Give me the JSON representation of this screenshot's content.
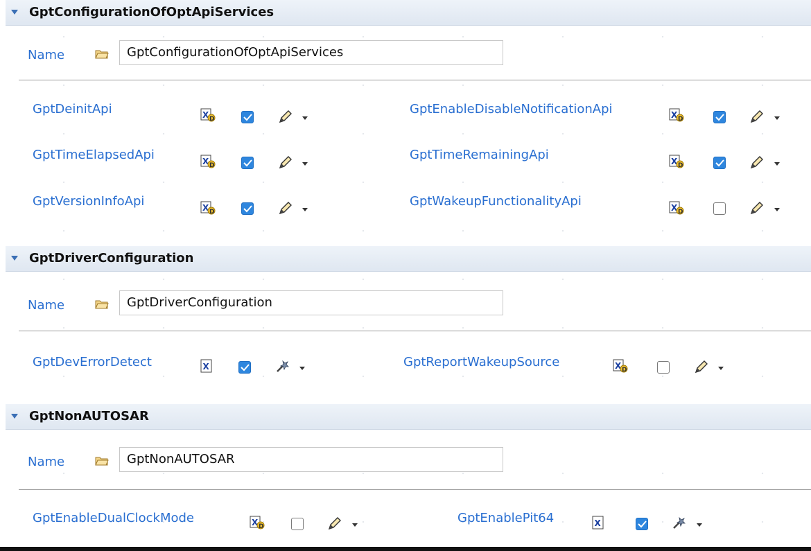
{
  "sections": [
    {
      "title": "GptConfigurationOfOptApiServices",
      "name_label": "Name",
      "name_value": "GptConfigurationOfOptApiServices",
      "params": [
        {
          "label": "GptDeinitApi",
          "icon": "xd-icon",
          "checked": true,
          "action_icon": "pencil-icon"
        },
        {
          "label": "GptEnableDisableNotificationApi",
          "icon": "xd-icon",
          "checked": true,
          "action_icon": "pencil-icon"
        },
        {
          "label": "GptTimeElapsedApi",
          "icon": "xd-icon",
          "checked": true,
          "action_icon": "pencil-icon"
        },
        {
          "label": "GptTimeRemainingApi",
          "icon": "xd-icon",
          "checked": true,
          "action_icon": "pencil-icon"
        },
        {
          "label": "GptVersionInfoApi",
          "icon": "xd-icon",
          "checked": true,
          "action_icon": "pencil-icon"
        },
        {
          "label": "GptWakeupFunctionalityApi",
          "icon": "xd-icon",
          "checked": false,
          "action_icon": "pencil-icon"
        }
      ]
    },
    {
      "title": "GptDriverConfiguration",
      "name_label": "Name",
      "name_value": "GptDriverConfiguration",
      "params": [
        {
          "label": "GptDevErrorDetect",
          "icon": "x-icon",
          "checked": true,
          "action_icon": "wand-icon"
        },
        {
          "label": "GptReportWakeupSource",
          "icon": "xd-icon",
          "checked": false,
          "action_icon": "pencil-icon"
        }
      ]
    },
    {
      "title": "GptNonAUTOSAR",
      "name_label": "Name",
      "name_value": "GptNonAUTOSAR",
      "params": [
        {
          "label": "GptEnableDualClockMode",
          "icon": "xd-icon",
          "checked": false,
          "action_icon": "pencil-icon"
        },
        {
          "label": "GptEnablePit64",
          "icon": "x-icon",
          "checked": true,
          "action_icon": "wand-icon"
        }
      ]
    }
  ],
  "colors": {
    "label_blue": "#2a6fd1",
    "check_blue": "#2e86de",
    "header_bg": "#e4ebf4"
  }
}
